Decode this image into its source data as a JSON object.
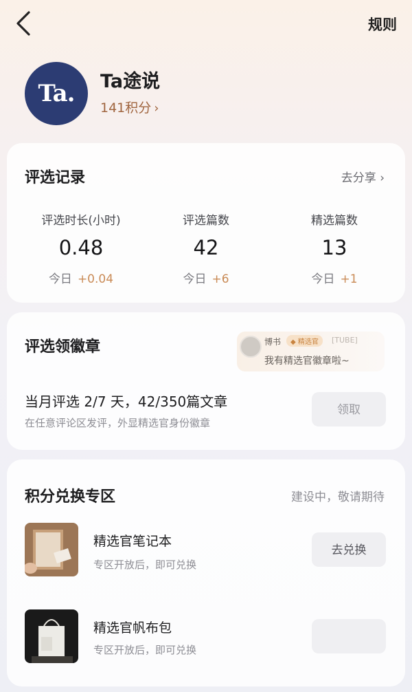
{
  "header": {
    "rules_label": "规则"
  },
  "profile": {
    "avatar_text": "Ta.",
    "name": "Ta途说",
    "points": "141积分"
  },
  "record": {
    "title": "评选记录",
    "share_link": "去分享 ›",
    "stats": [
      {
        "label": "评选时长(小时)",
        "value": "0.48",
        "today_label": "今日",
        "today_delta": "+0.04"
      },
      {
        "label": "评选篇数",
        "value": "42",
        "today_label": "今日",
        "today_delta": "+6"
      },
      {
        "label": "精选篇数",
        "value": "13",
        "today_label": "今日",
        "today_delta": "+1"
      }
    ]
  },
  "badge": {
    "title": "评选领徽章",
    "bubble": {
      "user": "博书",
      "badge": "精选官",
      "time": "[TUBE]",
      "message": "我有精选官徽章啦~"
    },
    "task_title": "当月评选 2/7 天，42/350篇文章",
    "task_sub": "在任意评论区发评，外显精选官身份徽章",
    "claim_button": "领取"
  },
  "exchange": {
    "title": "积分兑换专区",
    "status": "建设中，敬请期待",
    "items": [
      {
        "name": "精选官笔记本",
        "sub": "专区开放后，即可兑换",
        "button": "去兑换"
      },
      {
        "name": "精选官帆布包",
        "sub": "专区开放后，即可兑换",
        "button": ""
      }
    ]
  }
}
